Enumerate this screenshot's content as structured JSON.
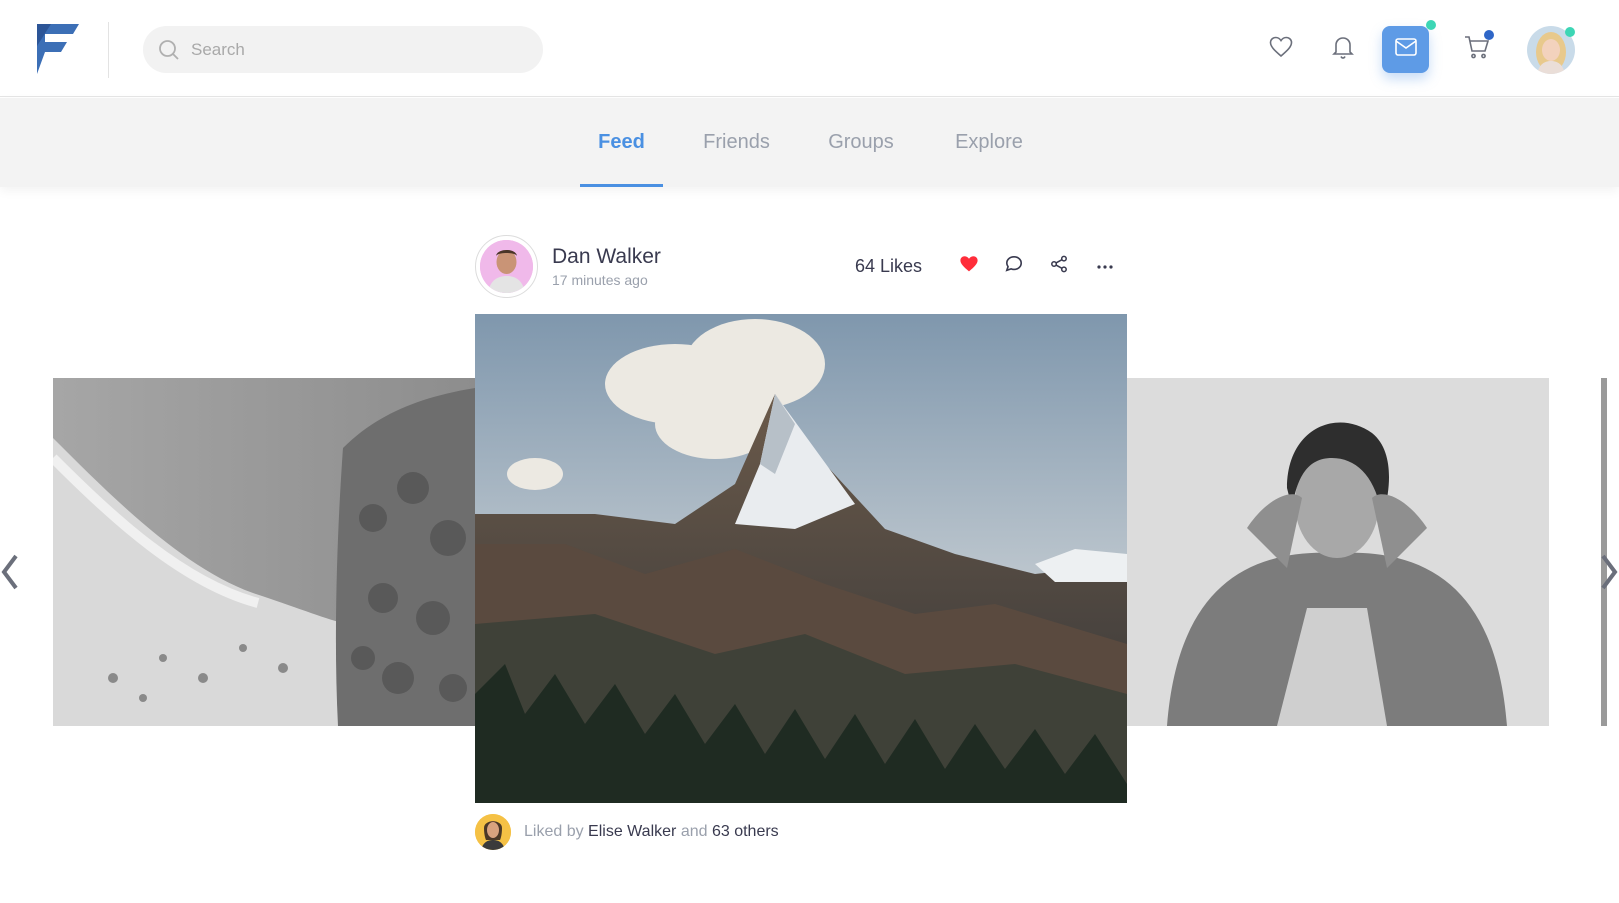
{
  "header": {
    "search_placeholder": "Search",
    "icons": [
      "logo-icon",
      "search-icon",
      "heart-icon",
      "bell-icon",
      "mail-icon",
      "cart-icon"
    ],
    "accent": "#5e9be6"
  },
  "tabs": [
    {
      "label": "Feed",
      "active": true
    },
    {
      "label": "Friends",
      "active": false
    },
    {
      "label": "Groups",
      "active": false
    },
    {
      "label": "Explore",
      "active": false
    }
  ],
  "post": {
    "author": "Dan Walker",
    "time": "17 minutes ago",
    "likes": "64 Likes",
    "liked_by_prefix": "Liked by",
    "liked_by_name": "Elise Walker",
    "liked_by_and": "and",
    "liked_by_others": "63 others"
  },
  "colors": {
    "active_tab": "#4a90e2",
    "like_heart": "#ff2d3a",
    "notification_green": "#3dd6b5",
    "notification_blue": "#2f66c7"
  }
}
